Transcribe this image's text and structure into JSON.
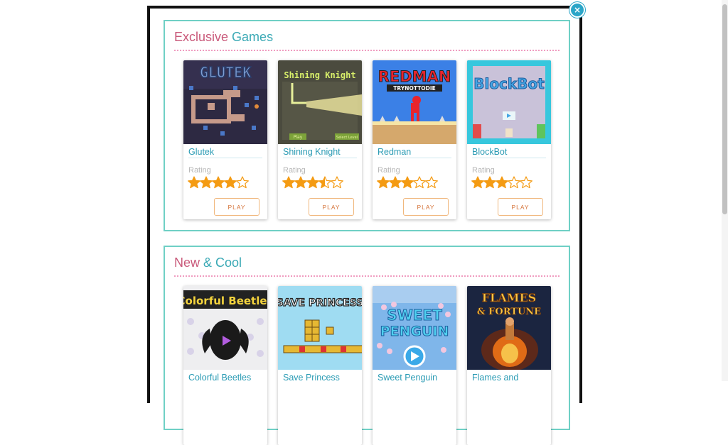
{
  "modal": {
    "close_label": "×"
  },
  "sections": [
    {
      "title_a": "Exclusive",
      "title_b": "Games",
      "games": [
        {
          "name": "Glutek",
          "rating_label": "Rating",
          "rating": 4,
          "play_label": "PLAY",
          "art_text": "GLUTEK"
        },
        {
          "name": "Shining Knight",
          "rating_label": "Rating",
          "rating": 3.5,
          "play_label": "PLAY",
          "art_text": "Shining Knight"
        },
        {
          "name": "Redman",
          "rating_label": "Rating",
          "rating": 3,
          "play_label": "PLAY",
          "art_text": "REDMAN",
          "art_subtext": "TRYNOTTODIE"
        },
        {
          "name": "BlockBot",
          "rating_label": "Rating",
          "rating": 3,
          "play_label": "PLAY",
          "art_text": "BlockBot"
        }
      ]
    },
    {
      "title_a": "New",
      "title_b": "& Cool",
      "games": [
        {
          "name": "Colorful Beetles",
          "art_text": "Colorful Beetles"
        },
        {
          "name": "Save Princess",
          "art_text": "SAVE PRINCESS"
        },
        {
          "name": "Sweet Penguin",
          "art_text": "SWEET",
          "art_subtext": "PENGUIN"
        },
        {
          "name": "Flames and",
          "art_text": "FLAMES",
          "art_subtext": "& FORTUNE"
        }
      ]
    }
  ],
  "colors": {
    "accent_teal": "#3aa9b5",
    "accent_pink": "#c9597a",
    "star": "#f49b13",
    "play_border": "#f0b77c"
  }
}
